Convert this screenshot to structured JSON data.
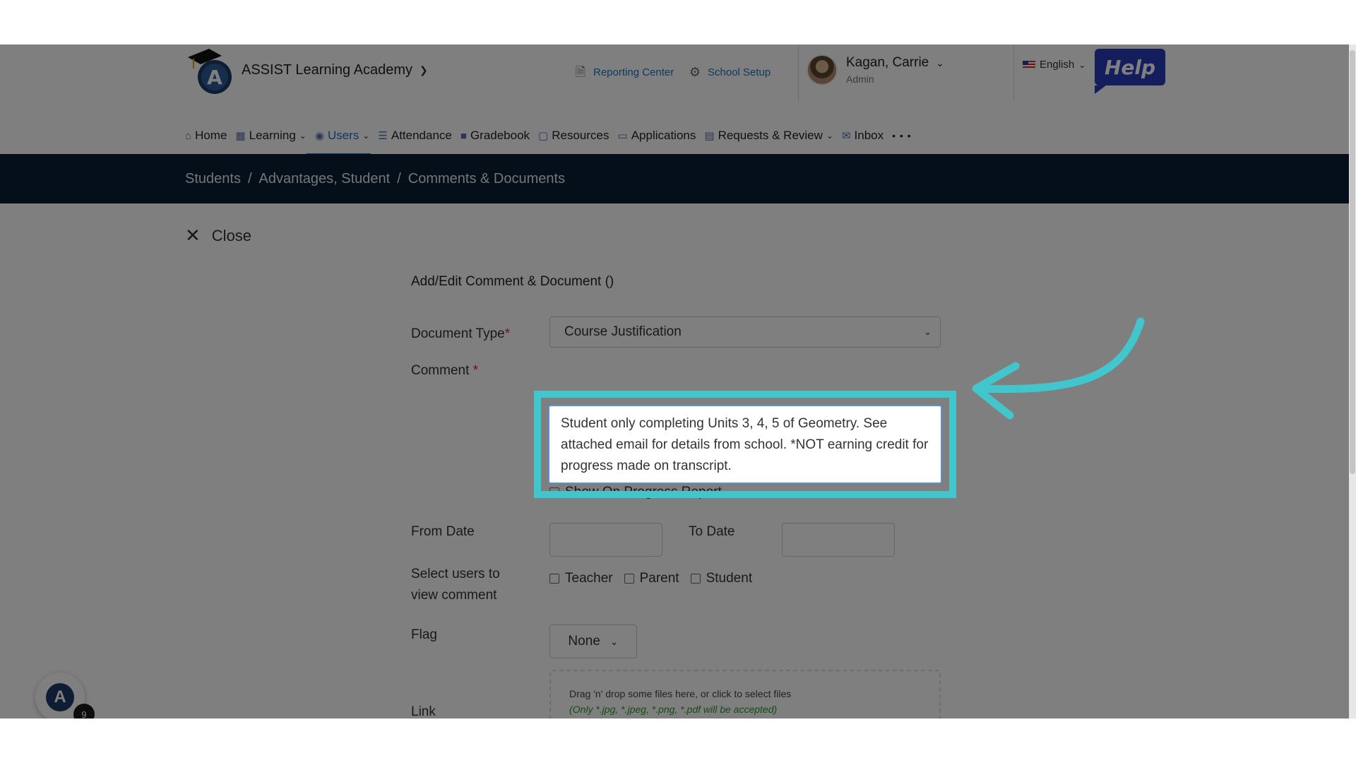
{
  "header": {
    "org_name": "ASSIST Learning Academy",
    "reporting_center": "Reporting Center",
    "school_setup": "School Setup",
    "user_name": "Kagan, Carrie",
    "user_role": "Admin",
    "language": "English",
    "help_label": "Help"
  },
  "nav": {
    "items": [
      {
        "label": "Home"
      },
      {
        "label": "Learning"
      },
      {
        "label": "Users"
      },
      {
        "label": "Attendance"
      },
      {
        "label": "Gradebook"
      },
      {
        "label": "Resources"
      },
      {
        "label": "Applications"
      },
      {
        "label": "Requests & Review"
      },
      {
        "label": "Inbox"
      }
    ],
    "more": "• • •"
  },
  "breadcrumb": {
    "items": [
      "Students",
      "Advantages, Student",
      "Comments & Documents"
    ],
    "separator": "/"
  },
  "close_label": "Close",
  "form": {
    "title": "Add/Edit Comment & Document ()",
    "document_type_label": "Document Type",
    "document_type_value": "Course Justification",
    "required_marker": "*",
    "comment_label": "Comment",
    "comment_value": "Student only completing Units 3, 4, 5 of Geometry. See attached email for details from school. *NOT earning credit for progress made on transcript.",
    "show_on_progress": "Show On Progress Report",
    "from_date_label": "From Date",
    "to_date_label": "To Date",
    "select_users_label": "Select users to view comment",
    "checkboxes": [
      {
        "label": "Teacher"
      },
      {
        "label": "Parent"
      },
      {
        "label": "Student"
      }
    ],
    "flag_label": "Flag",
    "flag_value": "None",
    "drop_text": "Drag 'n' drop some files here, or click to select files",
    "drop_note": "(Only *.jpg, *.jpeg, *.png, *.pdf will be accepted)",
    "link_label": "Link"
  },
  "fab_badge": "9",
  "colors": {
    "accent": "#1a73c8",
    "highlight": "#43c5cc",
    "band": "#0a1e33"
  }
}
